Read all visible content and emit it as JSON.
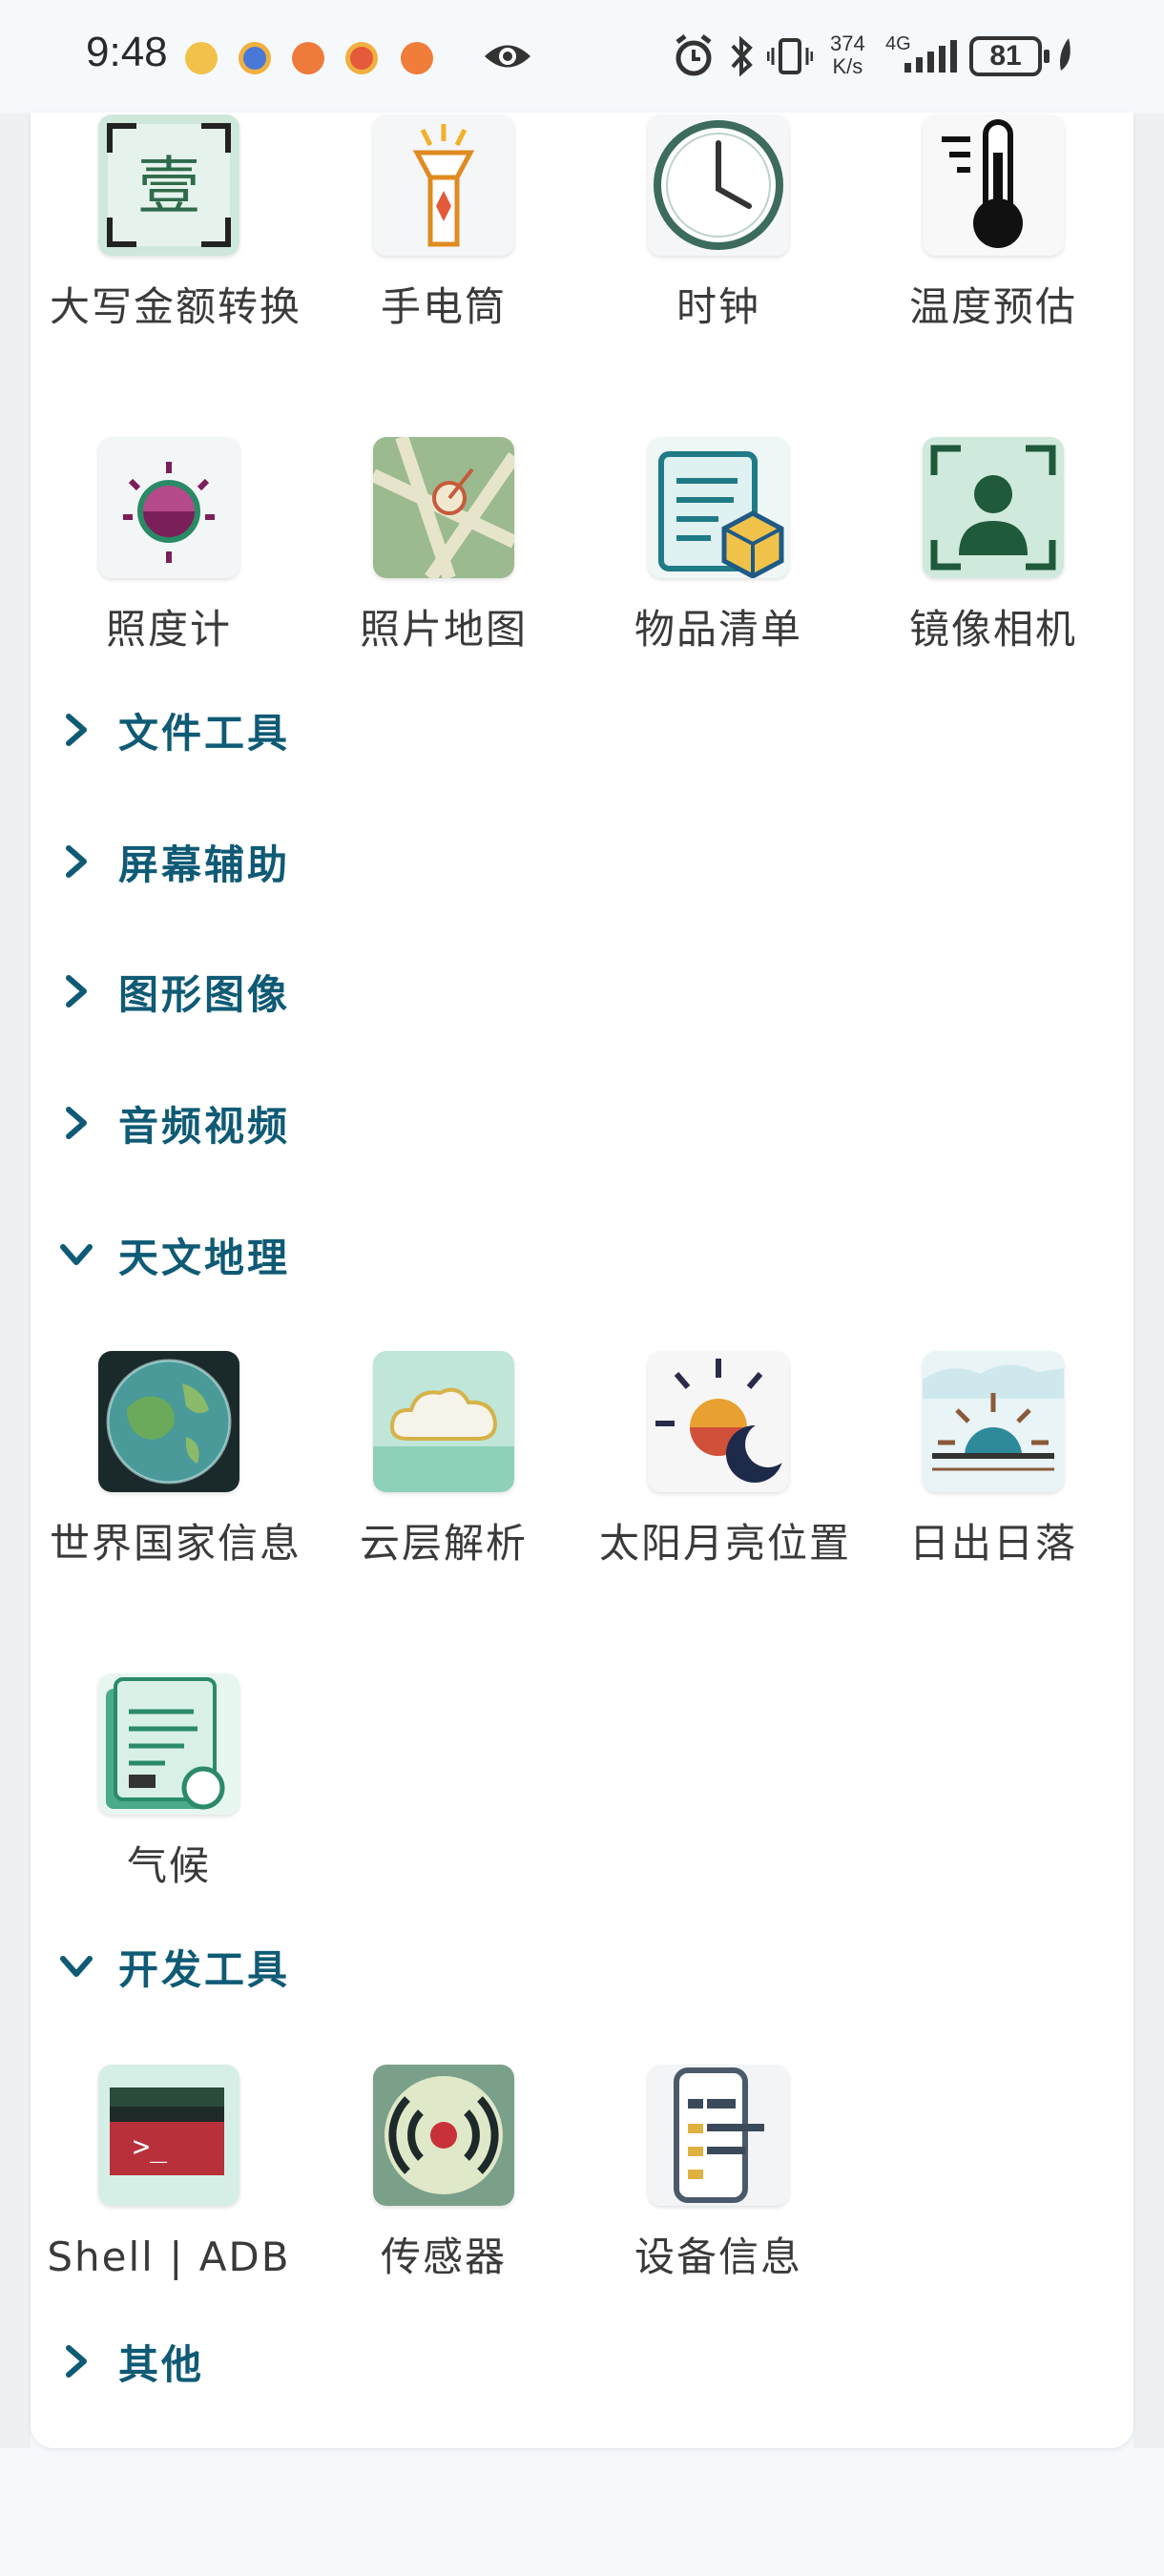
{
  "status_bar": {
    "time": "9:48",
    "net_speed_value": "374",
    "net_speed_unit": "K/s",
    "network": "4G",
    "battery": "81"
  },
  "colors": {
    "accent": "#0f5a75",
    "card_bg": "#ffffff",
    "page_bg": "#f5f9fc"
  },
  "top_grid": {
    "items": [
      {
        "label": "大写金额转换",
        "icon": "capital-amount-icon"
      },
      {
        "label": "手电筒",
        "icon": "flashlight-icon"
      },
      {
        "label": "时钟",
        "icon": "clock-icon"
      },
      {
        "label": "温度预估",
        "icon": "thermometer-icon"
      },
      {
        "label": "照度计",
        "icon": "light-meter-icon"
      },
      {
        "label": "照片地图",
        "icon": "photo-map-icon"
      },
      {
        "label": "物品清单",
        "icon": "item-list-icon"
      },
      {
        "label": "镜像相机",
        "icon": "mirror-camera-icon"
      }
    ],
    "capital_glyph": "壹"
  },
  "sections": {
    "file_tools": "文件工具",
    "screen_assist": "屏幕辅助",
    "graphics": "图形图像",
    "audio_video": "音频视频",
    "astronomy": "天文地理",
    "dev_tools": "开发工具",
    "other": "其他"
  },
  "astronomy_items": [
    {
      "label": "世界国家信息",
      "icon": "globe-icon"
    },
    {
      "label": "云层解析",
      "icon": "cloud-icon"
    },
    {
      "label": "太阳月亮位置",
      "icon": "sun-moon-icon"
    },
    {
      "label": "日出日落",
      "icon": "sunrise-icon"
    },
    {
      "label": "气候",
      "icon": "climate-icon"
    }
  ],
  "dev_items": [
    {
      "label": "Shell | ADB",
      "icon": "terminal-icon"
    },
    {
      "label": "传感器",
      "icon": "sensor-icon"
    },
    {
      "label": "设备信息",
      "icon": "device-info-icon"
    }
  ],
  "terminal_prompt": ">_"
}
